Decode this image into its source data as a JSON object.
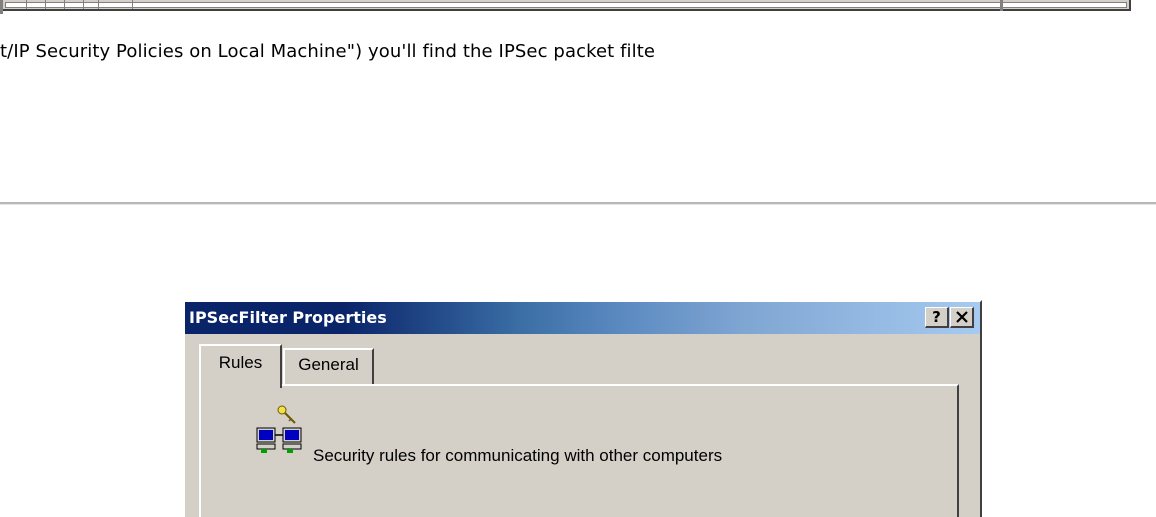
{
  "article": {
    "text": "t/IP Security Policies on Local Machine\") you'll find the IPSec packet filte"
  },
  "dialog": {
    "title": "IPSecFilter Properties",
    "help_label": "?",
    "close_label": "×",
    "tabs": [
      {
        "label": "Rules",
        "selected": true
      },
      {
        "label": "General",
        "selected": false
      }
    ],
    "panel": {
      "description": "Security rules for communicating with other computers",
      "icon": "networked-computers-key-icon"
    }
  },
  "colors": {
    "title_gradient_start": "#0a246a",
    "title_gradient_end": "#a6caf0",
    "face": "#d4d0c8"
  }
}
